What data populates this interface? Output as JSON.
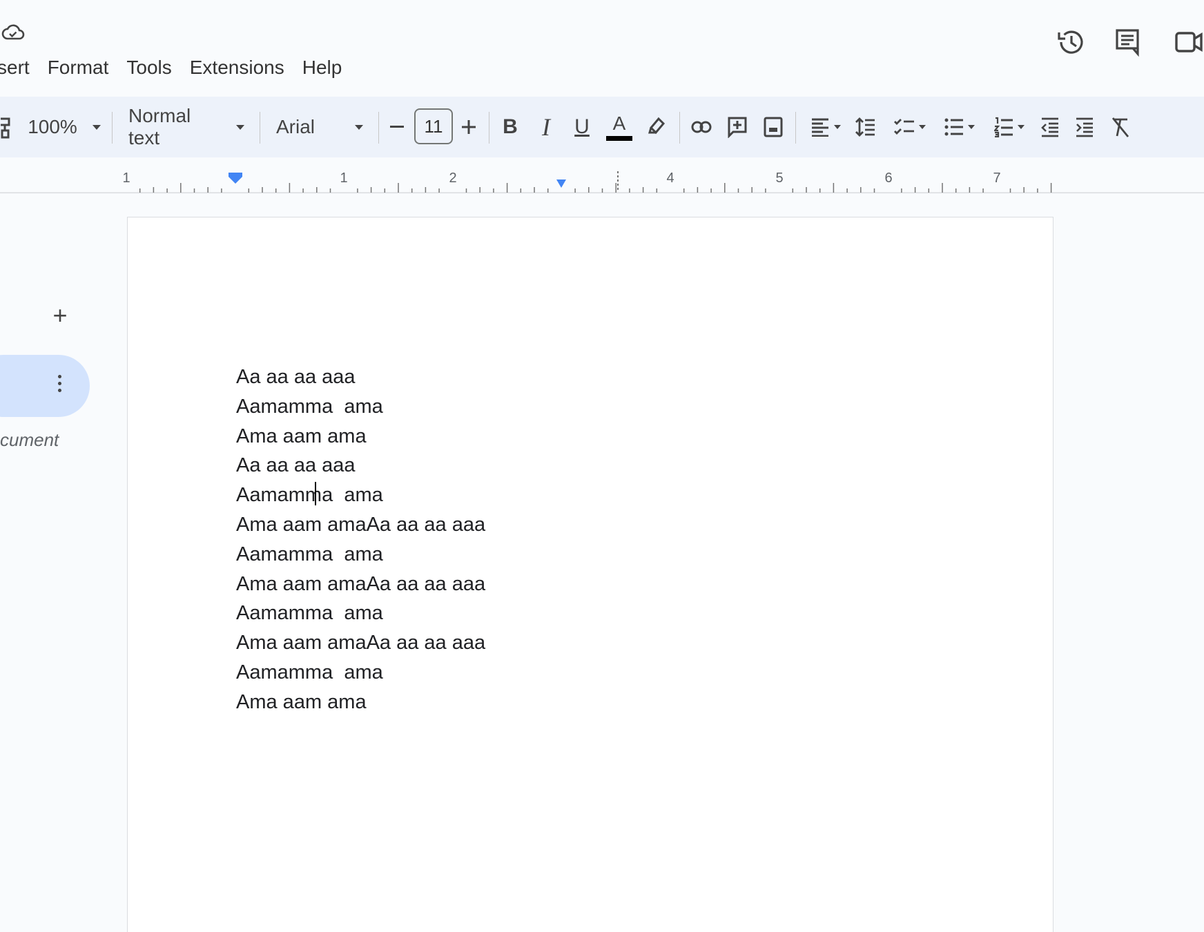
{
  "menu": [
    "sert",
    "Format",
    "Tools",
    "Extensions",
    "Help"
  ],
  "toolbar": {
    "zoom": "100%",
    "style": "Normal text",
    "font": "Arial",
    "font_size": "11",
    "text_color": "#000000",
    "bold_label": "B",
    "italic_label": "I",
    "underline_label": "U",
    "text_color_label": "A"
  },
  "ruler": {
    "labels": [
      "1",
      "1",
      "2",
      "4",
      "5",
      "6",
      "7"
    ],
    "marker_color": "#4285f4"
  },
  "outline": {
    "add_label": "+",
    "doc_label": "cument"
  },
  "document": {
    "lines": [
      "Aa aa aa aaa",
      "Aamamma  ama",
      "Ama aam ama",
      "Aa aa aa aaa",
      "Aamamma  ama",
      "Ama aam amaAa aa aa aaa",
      "Aamamma  ama",
      "Ama aam amaAa aa aa aaa",
      "Aamamma  ama",
      "Ama aam amaAa aa aa aaa",
      "Aamamma  ama",
      "Ama aam ama"
    ],
    "cursor_line": 4,
    "cursor_before": "Aamamm",
    "cursor_after": "a  ama"
  },
  "icons": [
    "cloud-save-icon",
    "history-icon",
    "comments-icon",
    "meet-icon",
    "paint-format-icon",
    "link-icon",
    "add-comment-icon",
    "insert-image-icon",
    "align-left-icon",
    "line-spacing-icon",
    "checklist-icon",
    "bulleted-list-icon",
    "numbered-list-icon",
    "decrease-indent-icon",
    "increase-indent-icon",
    "clear-formatting-icon",
    "highlight-icon"
  ]
}
